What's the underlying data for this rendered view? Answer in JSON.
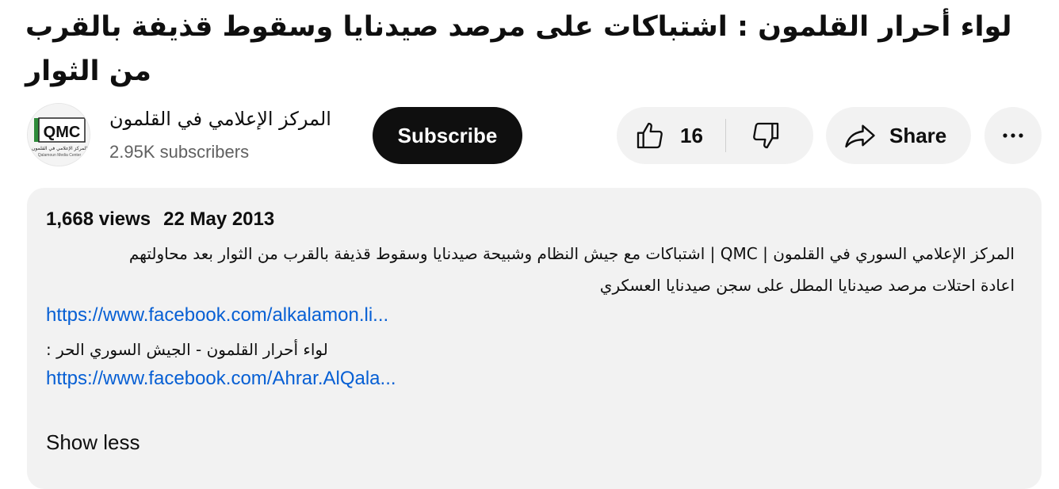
{
  "video": {
    "title": "لواء أحرار القلمون : اشتباكات على مرصد صيدنايا وسقوط قذيفة بالقرب من الثوار"
  },
  "channel": {
    "name": "المركز الإعلامي في القلمون",
    "subscribers": "2.95K subscribers",
    "avatar_text": "QMC",
    "avatar_caption": "المركز الإعلامي في القلمون",
    "avatar_subcaption": "Qalamoun Media Center"
  },
  "actions": {
    "subscribe_label": "Subscribe",
    "like_count": "16",
    "share_label": "Share",
    "more_label": "⋯",
    "like_icon": "thumbs-up-icon",
    "dislike_icon": "thumbs-down-icon",
    "share_icon": "share-arrow-icon",
    "more_icon": "more-horizontal-icon"
  },
  "description": {
    "views": "1,668 views",
    "date": "22 May 2013",
    "line1": "المركز الإعلامي السوري في القلمون | QMC | اشتباكات مع جيش النظام وشبيحة صيدنايا وسقوط قذيفة بالقرب من الثوار بعد محاولتهم",
    "line2": "اعادة احتلات مرصد صيدنايا المطل على سجن صيدنايا العسكري",
    "link1": "https://www.facebook.com/alkalamon.li...",
    "line3": "لواء أحرار القلمون - الجيش السوري الحر :",
    "link2": "https://www.facebook.com/Ahrar.AlQala...",
    "show_less": "Show less"
  },
  "colors": {
    "text": "#0f0f0f",
    "secondary": "#606060",
    "link": "#065fd4",
    "surface": "#f2f2f2",
    "logo_green": "#2e8b3a"
  }
}
